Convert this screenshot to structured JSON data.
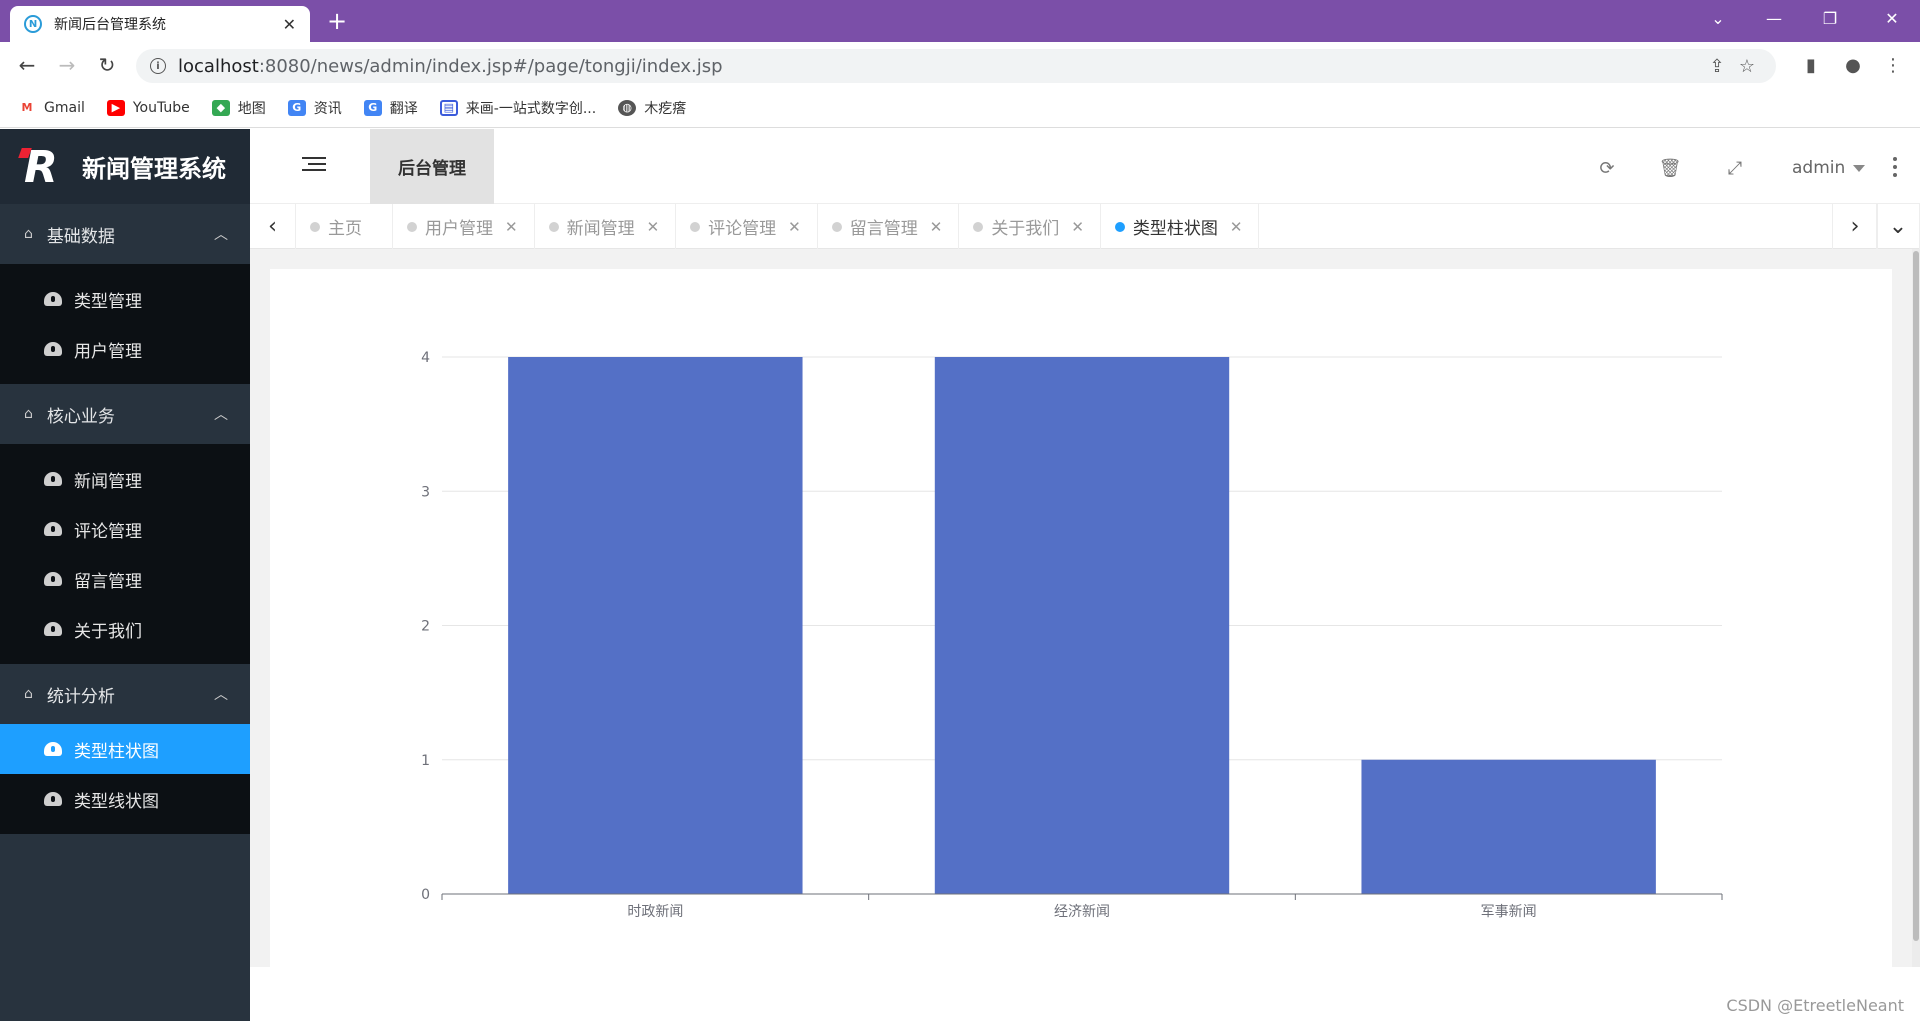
{
  "browser": {
    "tab_title": "新闻后台管理系统",
    "url_host": "localhost",
    "url_path": ":8080/news/admin/index.jsp#/page/tongji/index.jsp",
    "bookmarks": [
      {
        "label": "Gmail",
        "icon": "gmail-icon"
      },
      {
        "label": "YouTube",
        "icon": "youtube-icon"
      },
      {
        "label": "地图",
        "icon": "maps-icon"
      },
      {
        "label": "资讯",
        "icon": "news-icon"
      },
      {
        "label": "翻译",
        "icon": "translate-icon"
      },
      {
        "label": "来画-一站式数字创...",
        "icon": "laihua-icon"
      },
      {
        "label": "木疙瘩",
        "icon": "globe-icon"
      }
    ]
  },
  "app": {
    "logo_title": "新闻管理系统",
    "top_tab": "后台管理",
    "user": "admin"
  },
  "sidebar": {
    "groups": [
      {
        "label": "基础数据",
        "items": [
          "类型管理",
          "用户管理"
        ]
      },
      {
        "label": "核心业务",
        "items": [
          "新闻管理",
          "评论管理",
          "留言管理",
          "关于我们"
        ]
      },
      {
        "label": "统计分析",
        "items": [
          "类型柱状图",
          "类型线状图"
        ]
      }
    ],
    "active_item": "类型柱状图"
  },
  "page_tabs": [
    {
      "label": "主页",
      "closable": false,
      "active": false
    },
    {
      "label": "用户管理",
      "closable": true,
      "active": false
    },
    {
      "label": "新闻管理",
      "closable": true,
      "active": false
    },
    {
      "label": "评论管理",
      "closable": true,
      "active": false
    },
    {
      "label": "留言管理",
      "closable": true,
      "active": false
    },
    {
      "label": "关于我们",
      "closable": true,
      "active": false
    },
    {
      "label": "类型柱状图",
      "closable": true,
      "active": true
    }
  ],
  "chart_data": {
    "type": "bar",
    "categories": [
      "时政新闻",
      "经济新闻",
      "军事新闻"
    ],
    "values": [
      4,
      4,
      1
    ],
    "ylim": [
      0,
      4
    ],
    "yticks": [
      0,
      1,
      2,
      3,
      4
    ],
    "grid": true,
    "bar_color": "#5470c6"
  },
  "watermark": "CSDN @EtreetleNeant",
  "colors": {
    "browser_frame": "#7b4fa8",
    "sidebar": "#28333e",
    "active_blue": "#1e9fff"
  }
}
